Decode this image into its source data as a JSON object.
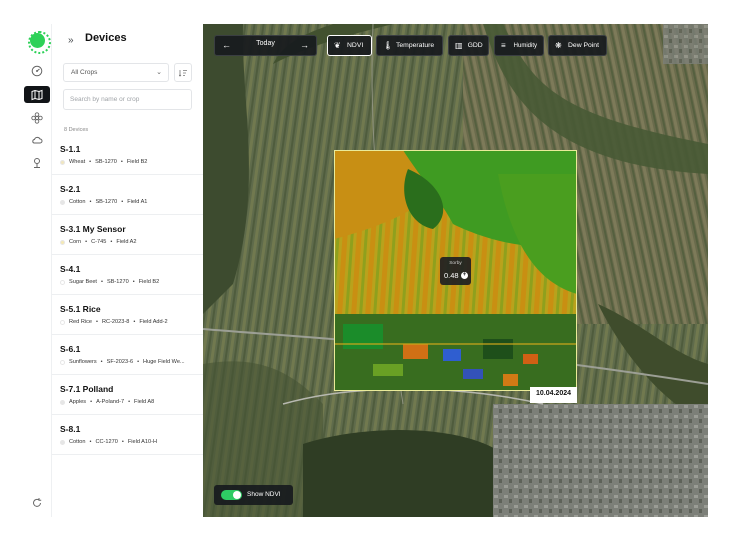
{
  "sidebar": {
    "title": "Devices",
    "crop_filter": "All Crops",
    "search_placeholder": "Search by name or crop",
    "count": "8 Devices",
    "devices": [
      {
        "name": "S-1.1",
        "crop": "Wheat",
        "code": "SB-1270",
        "field": "Field B2",
        "dot": "#f0e6c0"
      },
      {
        "name": "S-2.1",
        "crop": "Cotton",
        "code": "SB-1270",
        "field": "Field A1",
        "dot": "#e6e6e6"
      },
      {
        "name": "S-3.1 My Sensor",
        "crop": "Corn",
        "code": "C-745",
        "field": "Field A2",
        "dot": "#f5e9b5"
      },
      {
        "name": "S-4.1",
        "crop": "Sugar Beet",
        "code": "SB-1270",
        "field": "Field B2",
        "dot": "#ffffff"
      },
      {
        "name": "S-5.1 Rice",
        "crop": "Red Rice",
        "code": "RC-2023-8",
        "field": "Field Add-2",
        "dot": "#ffffff"
      },
      {
        "name": "S-6.1",
        "crop": "Sunflowers",
        "code": "SF-2023-6",
        "field": "Huge Field We...",
        "dot": "#ffffff"
      },
      {
        "name": "S-7.1 Polland",
        "crop": "Apples",
        "code": "A-Poland-7",
        "field": "Field A8",
        "dot": "#e6e6e6"
      },
      {
        "name": "S-8.1",
        "crop": "Cotton",
        "code": "CC-1270",
        "field": "Field A10-H",
        "dot": "#e6e6e6"
      }
    ]
  },
  "map": {
    "date_label": "Today",
    "layers": [
      {
        "label": "NDVI",
        "icon": "leaf-icon",
        "active": true
      },
      {
        "label": "Temperature",
        "icon": "thermometer-icon",
        "active": false
      },
      {
        "label": "GDD",
        "icon": "bar-chart-icon",
        "active": false
      },
      {
        "label": "Humidity",
        "icon": "waves-icon",
        "active": false
      },
      {
        "label": "Dew Point",
        "icon": "dew-point-icon",
        "active": false
      }
    ],
    "tooltip_title": "Sorby",
    "tooltip_value": "0.48",
    "tooltip_action": "+",
    "date_badge": "10.04.2024",
    "toggle_label": "Show NDVI",
    "toggle_on": true
  },
  "colors": {
    "accent": "#2ed158",
    "panel": "#181b1e"
  }
}
